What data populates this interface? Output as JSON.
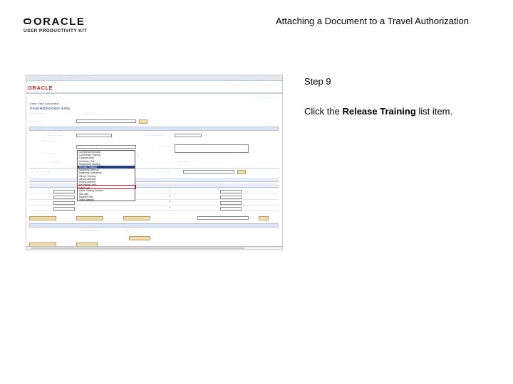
{
  "header": {
    "logo_brand": "ORACLE",
    "logo_product": "USER PRODUCTIVITY KIT",
    "title": "Attaching a Document to a Travel Authorization"
  },
  "step": {
    "number_label": "Step 9",
    "instruction_prefix": "Click the ",
    "instruction_target": "Release Training",
    "instruction_suffix": " list item."
  },
  "screenshot": {
    "brand": "ORACLE",
    "page_heading": "Travel Authorization Entry",
    "breadcrumb": "Create Travel Authorization",
    "dropdown_items": [
      "Conference/Seminar",
      "Conference Training",
      "Contract Work",
      "Customer Visit",
      "Department Meeting",
      "Release Training",
      "Marketing Seminar",
      "Marketing Tradeshow",
      "Off-site Training",
      "Off-site Meeting",
      "Project Meeting",
      "Recruiting Event",
      "Sales Call",
      "Sales Training Seminar",
      "Site Visit",
      "Supplier Visit",
      "Team Meeting",
      "Trade Show",
      "Training Course",
      "Vendor Visit"
    ],
    "highlighted_index": 5
  },
  "colors": {
    "highlight_border": "#d0102a",
    "selected_item_bg": "#1d3c8a",
    "oracle_red": "#d0261a"
  }
}
